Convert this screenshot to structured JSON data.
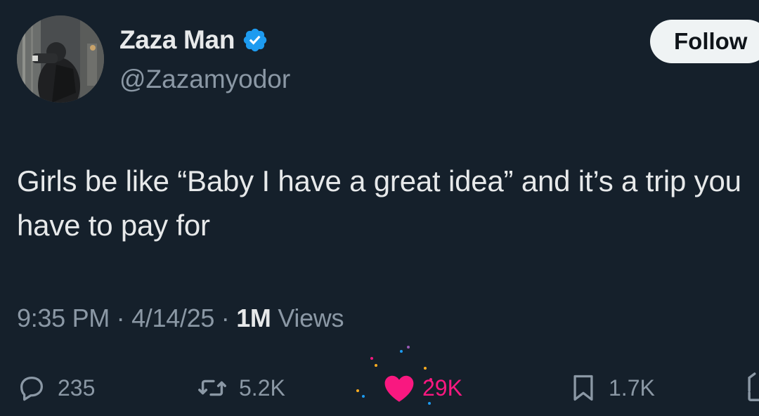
{
  "author": {
    "display_name": "Zaza Man",
    "handle": "@Zazamyodor",
    "verified": true,
    "verified_icon": "verified-badge-icon"
  },
  "follow_button": {
    "label": "Follow"
  },
  "tweet": {
    "text": "Girls be like “Baby I have a great idea” and it’s a trip you have to pay for"
  },
  "meta": {
    "time": "9:35 PM",
    "separator": "·",
    "date": "4/14/25",
    "views_count": "1M",
    "views_label": "Views"
  },
  "actions": {
    "replies": {
      "icon": "reply-icon",
      "count": "235"
    },
    "retweets": {
      "icon": "retweet-icon",
      "count": "5.2K"
    },
    "likes": {
      "icon": "heart-icon",
      "count": "29K",
      "liked": true
    },
    "bookmarks": {
      "icon": "bookmark-icon",
      "count": "1.7K"
    },
    "share": {
      "icon": "share-icon"
    }
  },
  "colors": {
    "background": "#15202b",
    "text_primary": "#e7e9ea",
    "text_secondary": "#8b98a5",
    "verified_blue": "#1d9bf0",
    "like_pink": "#f91880",
    "follow_bg": "#eff3f4"
  }
}
